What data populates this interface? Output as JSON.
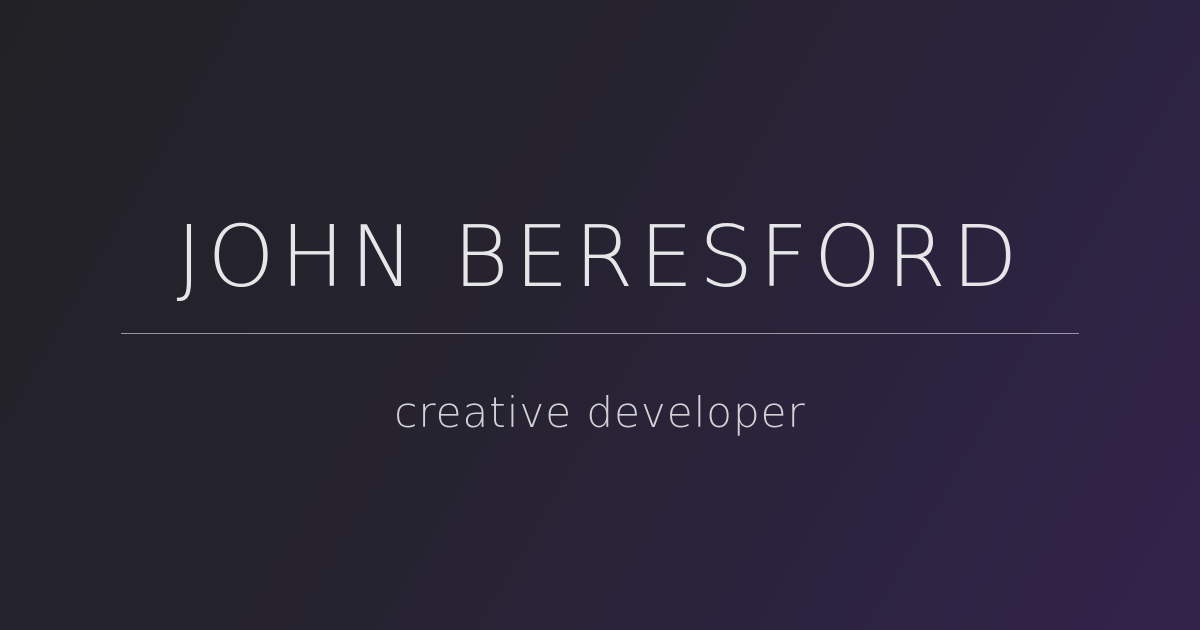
{
  "hero": {
    "name": "JOHN BERESFORD",
    "tagline": "creative developer"
  },
  "colors": {
    "background_start": "#222226",
    "background_end": "#33234a",
    "text": "#e6e6e8",
    "divider": "#9a96a3"
  }
}
